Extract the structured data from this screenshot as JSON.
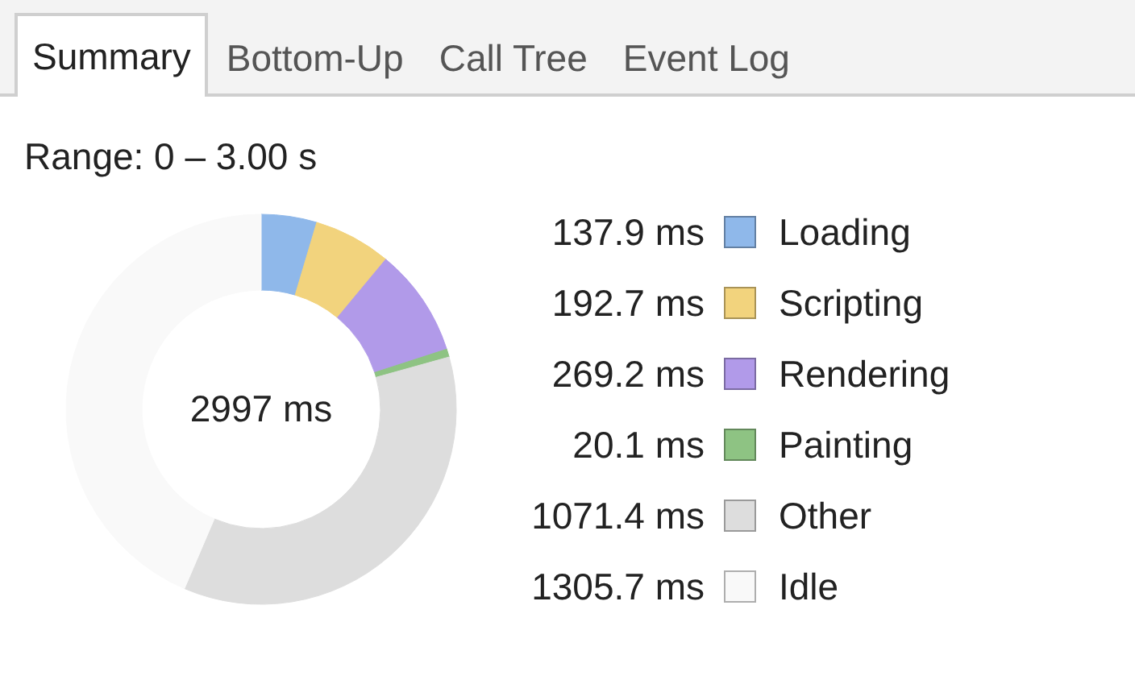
{
  "tabs": [
    {
      "label": "Summary",
      "selected": true
    },
    {
      "label": "Bottom-Up",
      "selected": false
    },
    {
      "label": "Call Tree",
      "selected": false
    },
    {
      "label": "Event Log",
      "selected": false
    }
  ],
  "range": "Range: 0 – 3.00 s",
  "summary": {
    "total": "2997 ms",
    "chart_data": {
      "type": "donut",
      "values": [
        4.6,
        6.43,
        8.98,
        0.67,
        35.75,
        43.57
      ]
    },
    "legend": [
      {
        "value": "137.9 ms",
        "label": "Loading",
        "color": "#8fb8ea"
      },
      {
        "value": "192.7 ms",
        "label": "Scripting",
        "color": "#f2d37d"
      },
      {
        "value": "269.2 ms",
        "label": "Rendering",
        "color": "#b19ae9"
      },
      {
        "value": "20.1 ms",
        "label": "Painting",
        "color": "#8ec383"
      },
      {
        "value": "1071.4 ms",
        "label": "Other",
        "color": "#dddddd"
      },
      {
        "value": "1305.7 ms",
        "label": "Idle",
        "color": "#f9f9f9"
      }
    ]
  }
}
